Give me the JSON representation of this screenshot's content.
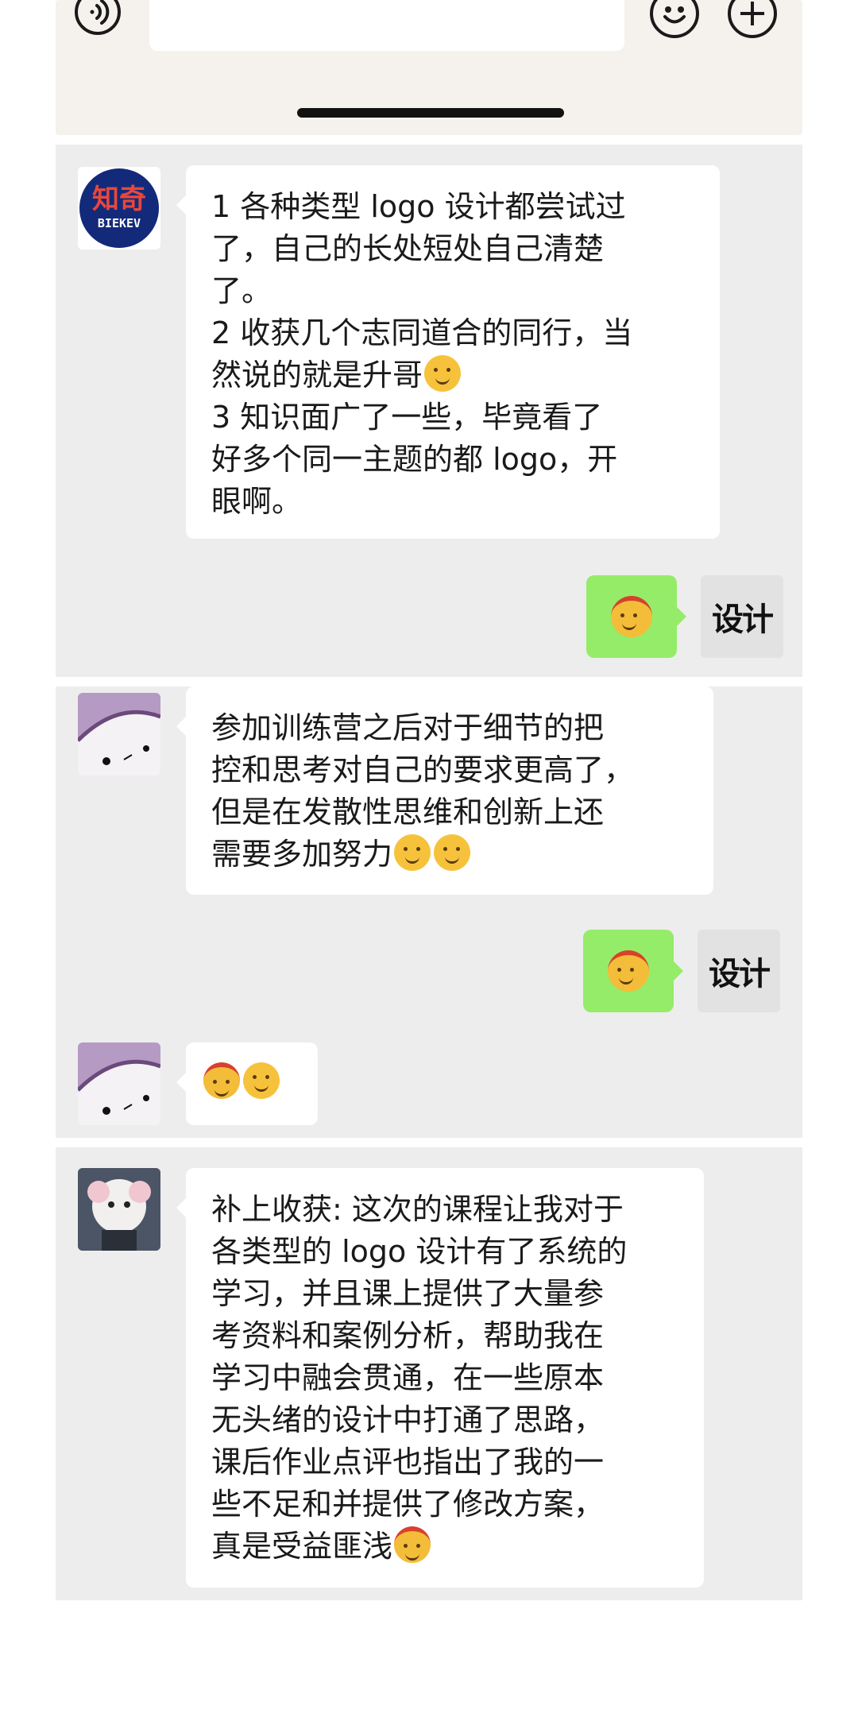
{
  "input_bar": {
    "voice_icon": "voice-icon",
    "emoji_icon": "emoji-icon",
    "plus_icon": "plus-icon"
  },
  "chat": {
    "me_avatar_label": "设计",
    "block1": {
      "avatar_brand": "BIEKEV",
      "message_lines": [
        "1 各种类型 logo 设计都尝试过",
        "了，自己的长处短处自己清楚",
        "了。",
        "2 收获几个志同道合的同行，当",
        "然说的就是升哥",
        "3 知识面广了一些，毕竟看了",
        "好多个同一主题的都 logo，开",
        "眼啊。"
      ]
    },
    "block2": {
      "message_lines": [
        "参加训练营之后对于细节的把",
        "控和思考对自己的要求更高了，",
        "但是在发散性思维和创新上还",
        "需要多加努力"
      ]
    },
    "block3": {
      "message_lines": [
        "补上收获: 这次的课程让我对于",
        "各类型的 logo 设计有了系统的",
        "学习，并且课上提供了大量参",
        "考资料和案例分析，帮助我在",
        "学习中融会贯通，在一些原本",
        "无头绪的设计中打通了思路，",
        "课后作业点评也指出了我的一",
        "些不足和并提供了修改方案，",
        "真是受益匪浅"
      ]
    }
  }
}
